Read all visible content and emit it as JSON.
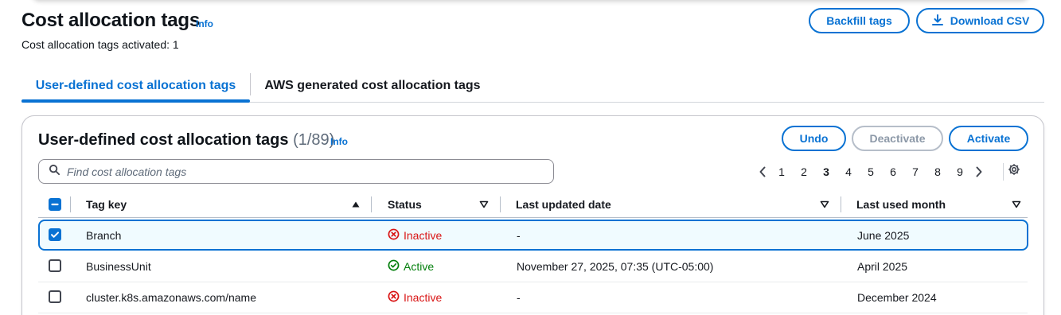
{
  "header": {
    "title": "Cost allocation tags",
    "info_label": "Info",
    "subtitle": "Cost allocation tags activated: 1",
    "backfill_label": "Backfill tags",
    "download_label": "Download CSV"
  },
  "tabs": [
    {
      "label": "User-defined cost allocation tags",
      "active": true
    },
    {
      "label": "AWS generated cost allocation tags",
      "active": false
    }
  ],
  "table_panel": {
    "title": "User-defined cost allocation tags",
    "count": "(1/89)",
    "info_label": "Info",
    "undo_label": "Undo",
    "deactivate_label": "Deactivate",
    "activate_label": "Activate",
    "search_placeholder": "Find cost allocation tags",
    "pagination": {
      "pages": [
        "1",
        "2",
        "3",
        "4",
        "5",
        "6",
        "7",
        "8",
        "9"
      ],
      "current_page": "3"
    },
    "columns": {
      "tag_key": "Tag key",
      "status": "Status",
      "last_updated": "Last updated date",
      "last_used": "Last used month"
    },
    "rows": [
      {
        "tag_key": "Branch",
        "status": "Inactive",
        "last_updated": "-",
        "last_used": "June 2025",
        "selected": true
      },
      {
        "tag_key": "BusinessUnit",
        "status": "Active",
        "last_updated": "November 27, 2025, 07:35 (UTC-05:00)",
        "last_used": "April 2025",
        "selected": false
      },
      {
        "tag_key": "cluster.k8s.amazonaws.com/name",
        "status": "Inactive",
        "last_updated": "-",
        "last_used": "December 2024",
        "selected": false
      }
    ]
  },
  "colors": {
    "accent": "#0972d3",
    "inactive": "#d91515",
    "active": "#037f0c",
    "disabled": "#8d99a8"
  },
  "icons": {
    "download": "download-icon",
    "search": "search-icon",
    "settings": "gear-icon",
    "prev": "chevron-left-icon",
    "next": "chevron-right-icon",
    "inactive": "x-circle-icon",
    "active": "check-circle-icon"
  }
}
